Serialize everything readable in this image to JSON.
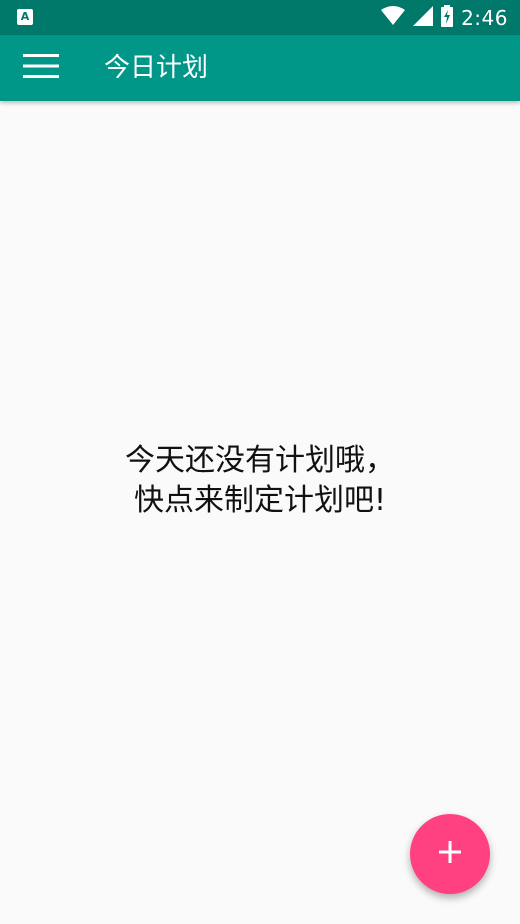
{
  "status_bar": {
    "app_icon_glyph": "A",
    "time": "2:46",
    "icons": [
      "wifi-icon",
      "signal-icon",
      "battery-icon"
    ]
  },
  "toolbar": {
    "menu_icon": "hamburger-menu-icon",
    "title": "今日计划"
  },
  "main": {
    "empty_message_line1": "今天还没有计划哦，",
    "empty_message_line2": "快点来制定计划吧!"
  },
  "fab": {
    "icon": "add-icon",
    "glyph": "+"
  },
  "colors": {
    "status_bar": "#00796b",
    "toolbar": "#009688",
    "fab": "#ff4081",
    "background": "#fafafa"
  }
}
